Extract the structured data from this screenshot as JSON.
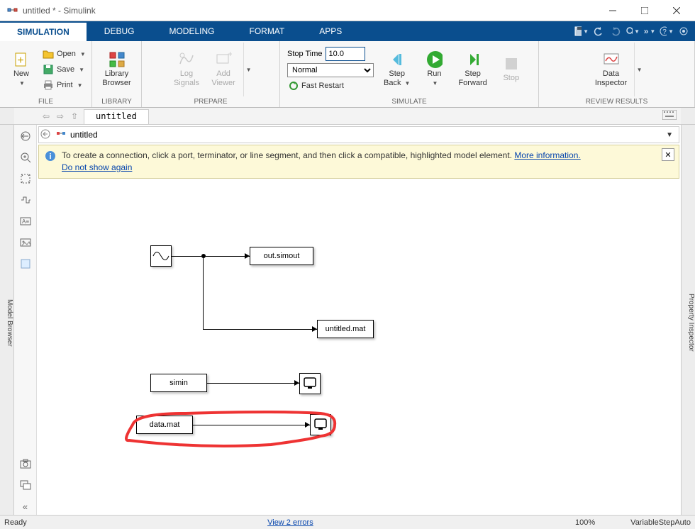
{
  "window": {
    "title": "untitled * - Simulink"
  },
  "tabs": {
    "simulation": "SIMULATION",
    "debug": "DEBUG",
    "modeling": "MODELING",
    "format": "FORMAT",
    "apps": "APPS"
  },
  "toolstrip": {
    "file": {
      "new": "New",
      "open": "Open",
      "save": "Save",
      "print": "Print",
      "group": "FILE"
    },
    "library": {
      "btn": "Library\nBrowser",
      "group": "LIBRARY"
    },
    "prepare": {
      "log": "Log\nSignals",
      "add": "Add\nViewer",
      "group": "PREPARE"
    },
    "simulate": {
      "stoptime_label": "Stop Time",
      "stoptime_value": "10.0",
      "mode": "Normal",
      "fastrestart": "Fast Restart",
      "stepback": "Step\nBack",
      "run": "Run",
      "stepfwd": "Step\nForward",
      "stop": "Stop",
      "group": "SIMULATE"
    },
    "review": {
      "datainsp": "Data\nInspector",
      "group": "REVIEW RESULTS"
    }
  },
  "doc": {
    "tab": "untitled",
    "breadcrumb": "untitled"
  },
  "sidepanels": {
    "left": "Model Browser",
    "right": "Property Inspector"
  },
  "infobar": {
    "msg1": "To create a connection, click a port, terminator, or line segment, and then click a compatible, highlighted model element. ",
    "moreinfo": "More information.",
    "dontshow": "Do not show again"
  },
  "blocks": {
    "outsimout": "out.simout",
    "untitledmat": "untitled.mat",
    "simin": "simin",
    "datamat": "data.mat"
  },
  "status": {
    "ready": "Ready",
    "errors": "View 2 errors",
    "zoom": "100%",
    "solver": "VariableStepAuto"
  }
}
